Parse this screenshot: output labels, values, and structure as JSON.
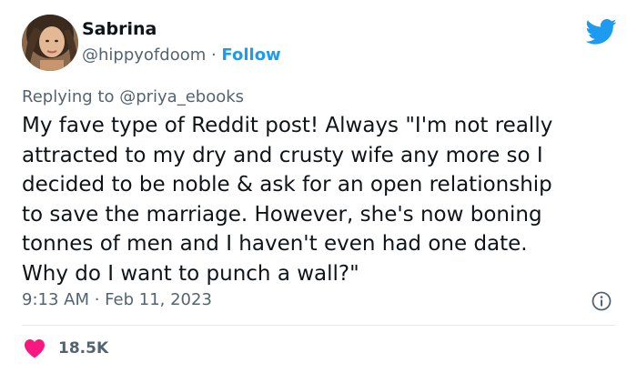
{
  "author": {
    "display_name": "Sabrina",
    "handle": "@hippyofdoom",
    "separator": " · ",
    "follow_label": "Follow"
  },
  "reply": {
    "prefix": "Replying to ",
    "handle": "@priya_ebooks"
  },
  "tweet": {
    "lines": [
      "My fave type of Reddit post! Always \"I'm not really",
      "attracted to my dry and crusty wife any more so I",
      "decided to be noble & ask for an open relationship",
      "to save the marriage. However, she's now boning",
      "tonnes of men and I haven't even had one date.",
      "Why do I want to punch a wall?\""
    ]
  },
  "meta": {
    "timestamp": "9:13 AM · Feb 11, 2023"
  },
  "engagement": {
    "likes": "18.5K"
  },
  "icons": {
    "brand": "twitter-bird-icon",
    "info": "info-icon",
    "like": "heart-icon"
  },
  "colors": {
    "brand_blue": "#1d9bf0",
    "heart_red": "#f91880",
    "muted_text": "#536471",
    "text": "#0f1419"
  }
}
